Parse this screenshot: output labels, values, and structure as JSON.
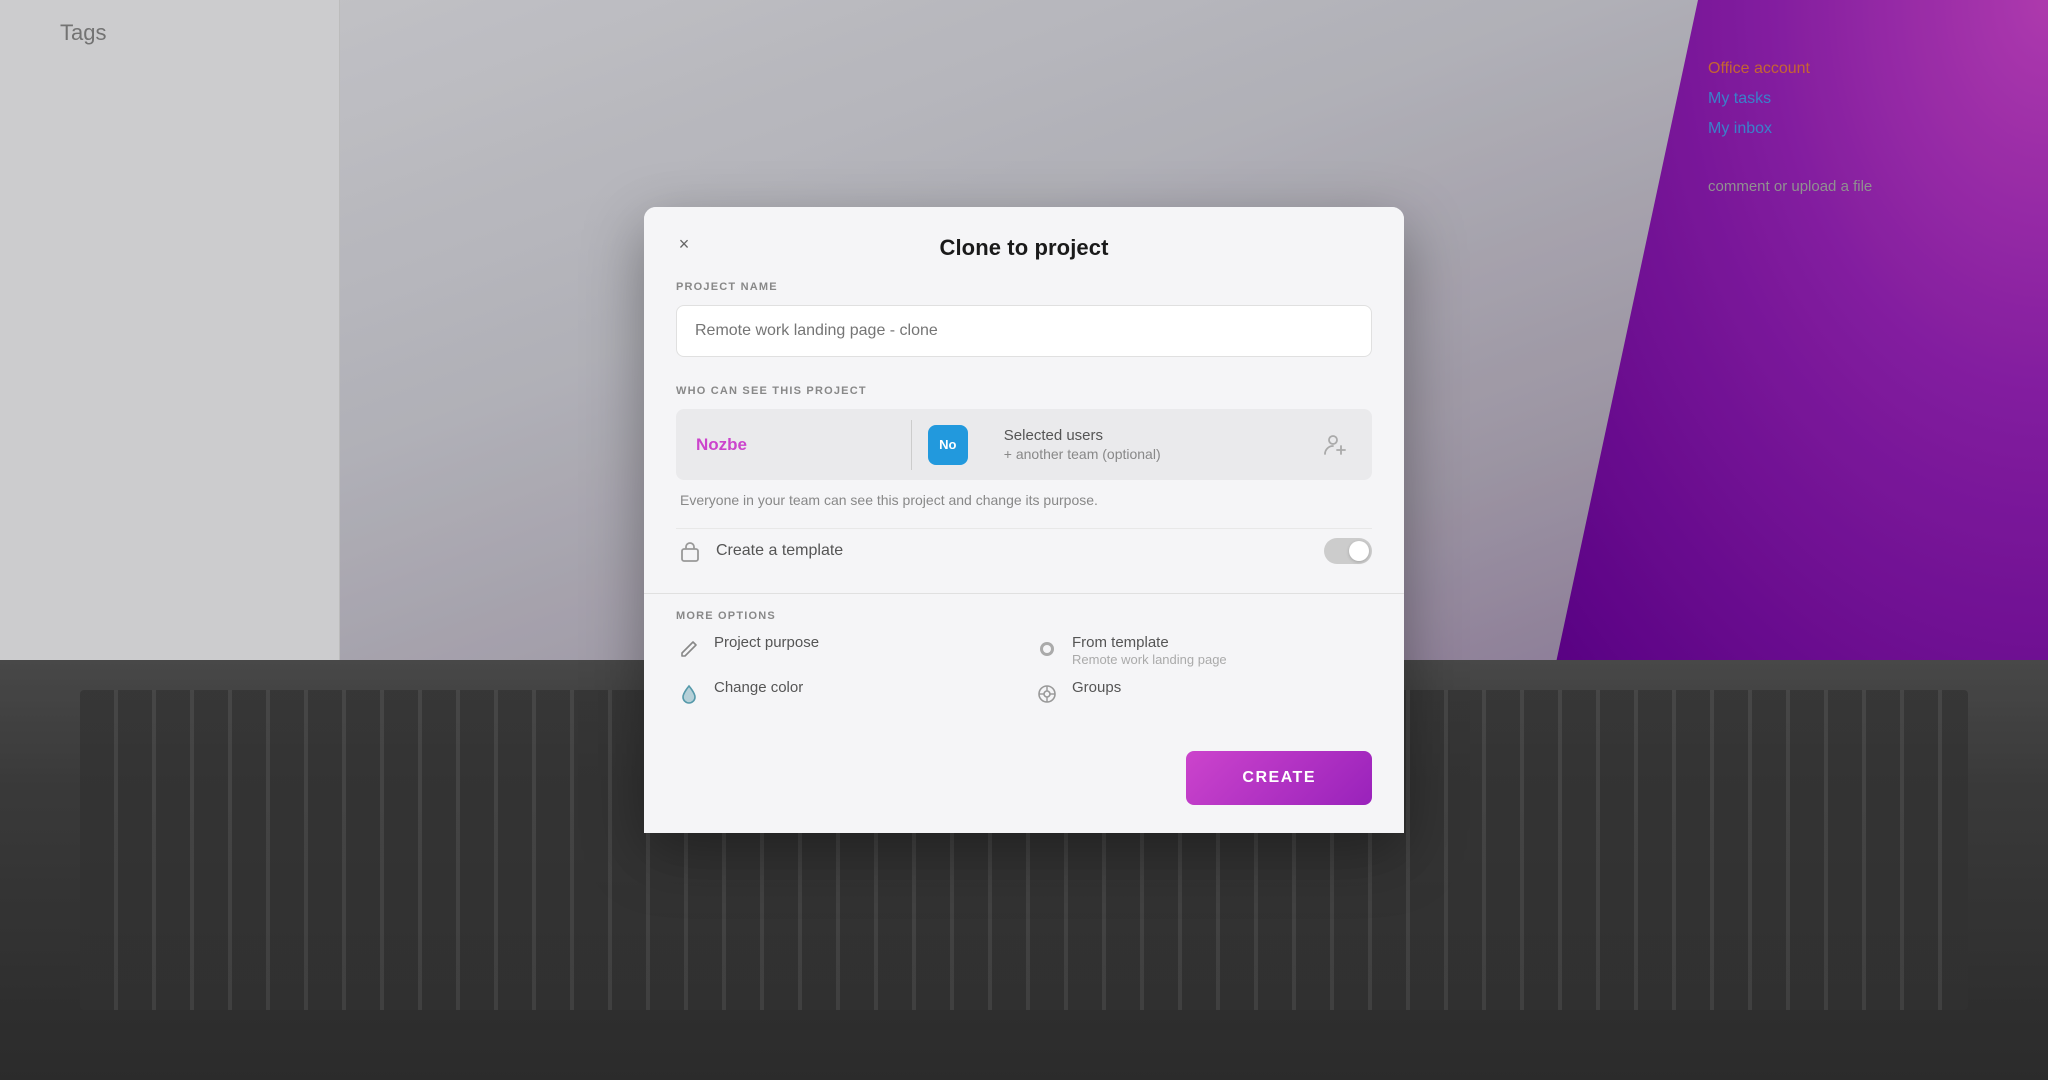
{
  "background": {
    "tags_label": "Tags"
  },
  "dialog": {
    "title": "Clone to project",
    "close_label": "×",
    "project_name_label": "PROJECT NAME",
    "project_name_placeholder": "Remote work landing page - clone",
    "visibility_label": "WHO CAN SEE THIS PROJECT",
    "team_name": "Nozbe",
    "no_badge": "No",
    "selected_users_title": "Selected users",
    "another_team": "+ another team (optional)",
    "visibility_note": "Everyone in your team can see this project and change its purpose.",
    "template_label": "Create a template",
    "more_options_label": "MORE OPTIONS",
    "options": [
      {
        "icon": "✏️",
        "label": "Project purpose",
        "sublabel": ""
      },
      {
        "icon": "●",
        "label": "From template",
        "sublabel": "Remote work landing page"
      },
      {
        "icon": "💧",
        "label": "Change color",
        "sublabel": ""
      },
      {
        "icon": "⊙",
        "label": "Groups",
        "sublabel": ""
      }
    ],
    "create_button": "CREATE"
  },
  "right_panel": {
    "link1": "Office account",
    "link2": "My tasks",
    "link3": "My inbox",
    "comment_hint": "comment or upload a file"
  }
}
